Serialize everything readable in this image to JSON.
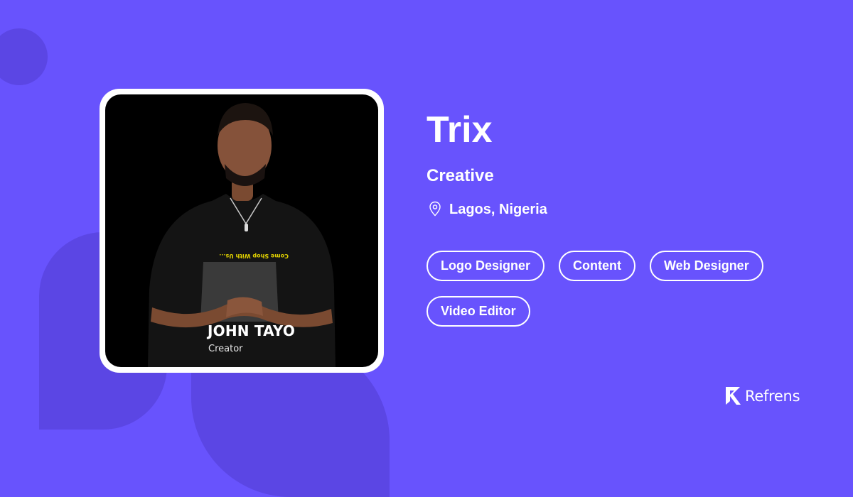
{
  "profile": {
    "name": "Trix",
    "title": "Creative",
    "location": "Lagos, Nigeria",
    "location_icon": "location-pin-icon"
  },
  "photo": {
    "overlay_name": "JOHN TAYO",
    "overlay_role": "Creator",
    "shirt_text": "Come Shop With Us..."
  },
  "skills": [
    "Logo Designer",
    "Content",
    "Web Designer",
    "Video Editor"
  ],
  "brand": {
    "name": "Refrens",
    "icon": "refrens-logo-icon"
  },
  "colors": {
    "background": "#6853FD",
    "decoration": "#5B46E4",
    "text": "#FFFFFF"
  }
}
